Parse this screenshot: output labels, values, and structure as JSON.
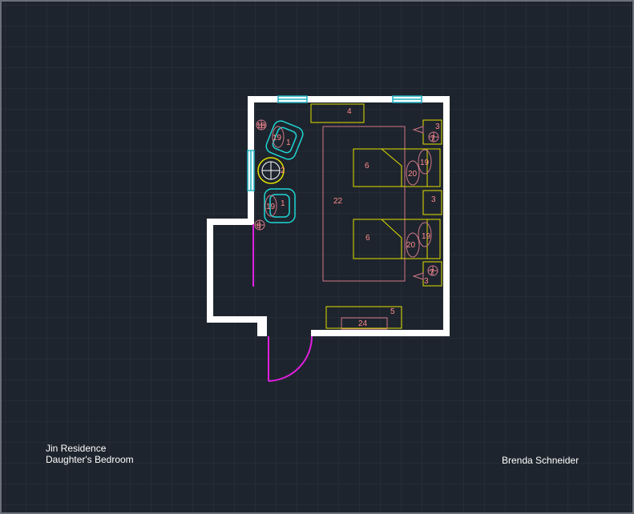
{
  "title_block": {
    "project": "Jin Residence",
    "room": "Daughter's Bedroom",
    "designer": "Brenda Schneider"
  },
  "colors": {
    "background": "#1e242d",
    "grid": "#2c333d",
    "wall": "#ffffff",
    "furniture": "#e0e000",
    "window": "#1fb0c0",
    "chair": "#1fd6d6",
    "door": "#e020e0",
    "rug": "#d07888",
    "tags": "#ff8c8c"
  },
  "tags": {
    "window_seat": "4",
    "nightstand_top": "3",
    "nightstand_middle": "3",
    "nightstand_bottom": "3",
    "lamp_top": "7",
    "lamp_bottom": "7",
    "lamp_left_top": "18",
    "lamp_left_bottom": "8",
    "bed_top": "6",
    "bed_bottom": "6",
    "pillow_top_a": "20",
    "pillow_top_b": "19",
    "pillow_bottom_a": "20",
    "pillow_bottom_b": "19",
    "rug": "22",
    "chair_top": "1",
    "chair_top_cushion": "19",
    "chair_bottom": "1",
    "chair_bottom_cushion": "19",
    "side_table": "2",
    "dresser": "5",
    "desk": "24"
  }
}
